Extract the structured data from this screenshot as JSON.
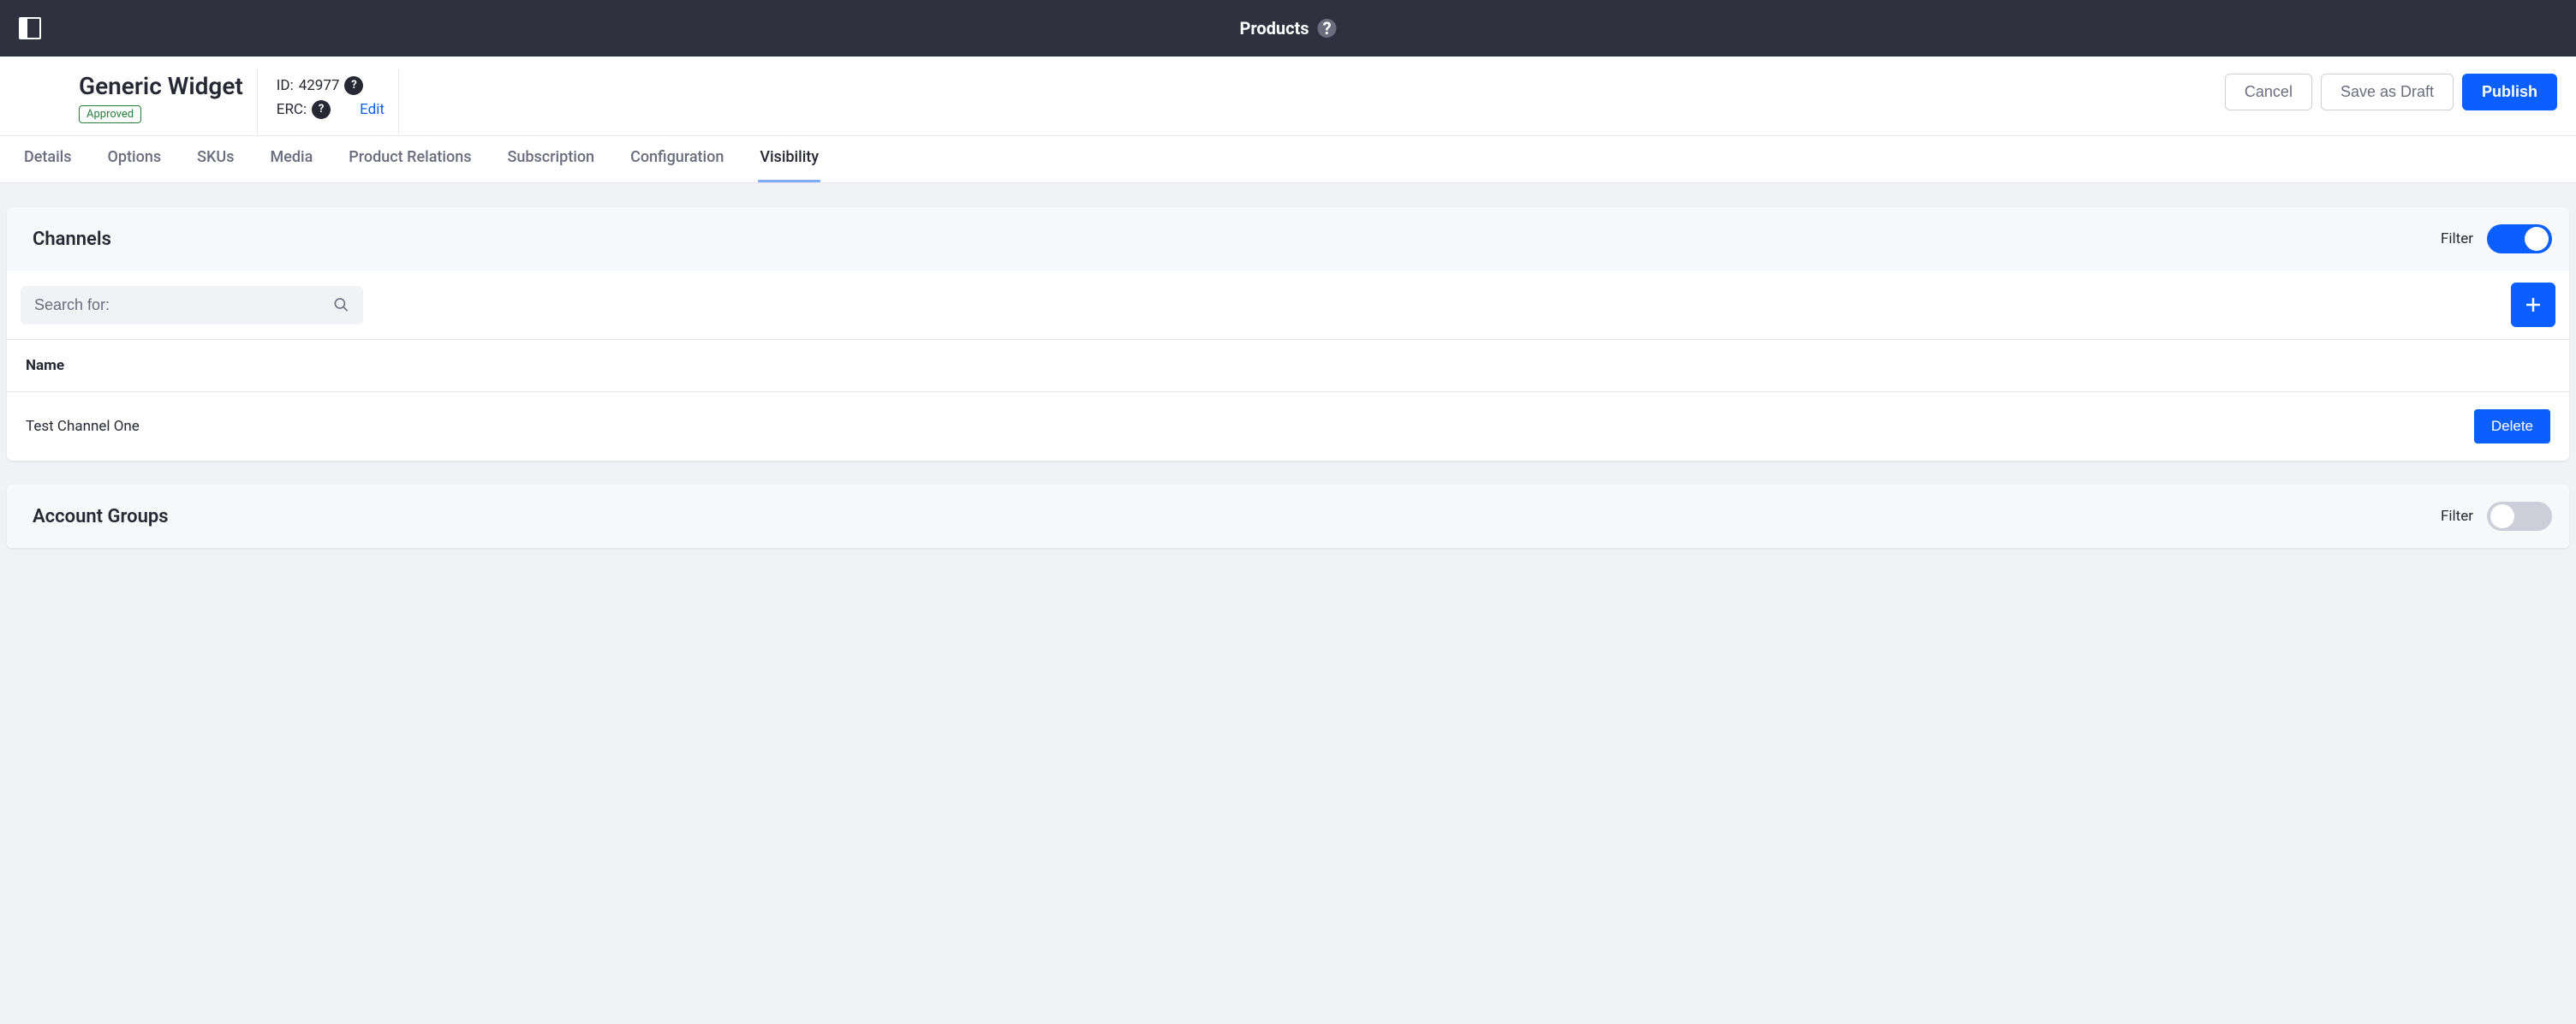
{
  "topbar": {
    "title": "Products"
  },
  "header": {
    "product_title": "Generic Widget",
    "status": "Approved",
    "id_label": "ID:",
    "id_value": "42977",
    "erc_label": "ERC:",
    "edit_label": "Edit",
    "actions": {
      "cancel": "Cancel",
      "save_draft": "Save as Draft",
      "publish": "Publish"
    }
  },
  "tabs": [
    {
      "label": "Details"
    },
    {
      "label": "Options"
    },
    {
      "label": "SKUs"
    },
    {
      "label": "Media"
    },
    {
      "label": "Product Relations"
    },
    {
      "label": "Subscription"
    },
    {
      "label": "Configuration"
    },
    {
      "label": "Visibility",
      "active": true
    }
  ],
  "channels": {
    "title": "Channels",
    "filter_label": "Filter",
    "filter_on": true,
    "search_placeholder": "Search for:",
    "col_name": "Name",
    "rows": [
      {
        "name": "Test Channel One",
        "delete_label": "Delete"
      }
    ]
  },
  "account_groups": {
    "title": "Account Groups",
    "filter_label": "Filter",
    "filter_on": false
  }
}
